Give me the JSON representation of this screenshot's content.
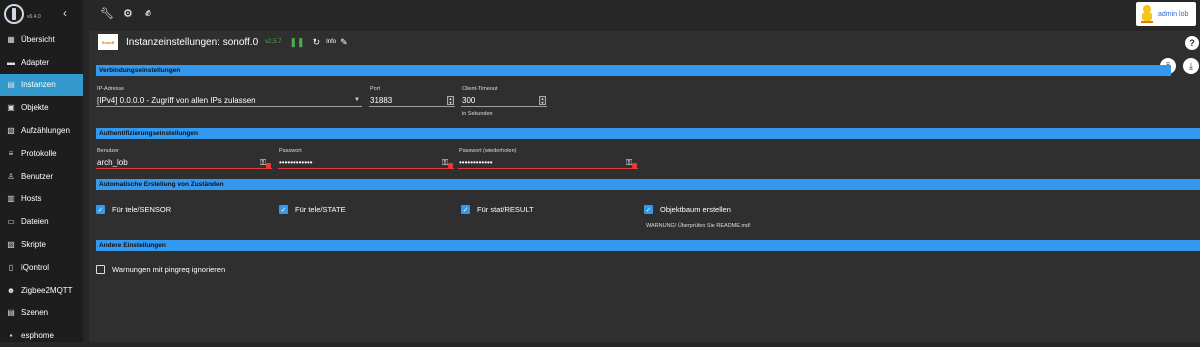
{
  "app": {
    "version": "v6.4.0"
  },
  "sidebar": {
    "items": [
      {
        "label": "Übersicht",
        "icon": "grid-icon",
        "glyph": "▦",
        "active": false
      },
      {
        "label": "Adapter",
        "icon": "store-icon",
        "glyph": "▬",
        "active": false
      },
      {
        "label": "Instanzen",
        "icon": "instances-icon",
        "glyph": "▤",
        "active": true
      },
      {
        "label": "Objekte",
        "icon": "objects-icon",
        "glyph": "▣",
        "active": false
      },
      {
        "label": "Aufzählungen",
        "icon": "enums-icon",
        "glyph": "▧",
        "active": false
      },
      {
        "label": "Protokolle",
        "icon": "logs-icon",
        "glyph": "≡",
        "active": false
      },
      {
        "label": "Benutzer",
        "icon": "user-icon",
        "glyph": "♙",
        "active": false
      },
      {
        "label": "Hosts",
        "icon": "hosts-icon",
        "glyph": "▥",
        "active": false
      },
      {
        "label": "Dateien",
        "icon": "files-icon",
        "glyph": "▭",
        "active": false
      },
      {
        "label": "Skripte",
        "icon": "scripts-icon",
        "glyph": "▨",
        "active": false
      },
      {
        "label": "iQontrol",
        "icon": "iqontrol-icon",
        "glyph": "▯",
        "active": false
      },
      {
        "label": "Zigbee2MQTT",
        "icon": "zigbee-icon",
        "glyph": "☻",
        "active": false
      },
      {
        "label": "Szenen",
        "icon": "scenes-icon",
        "glyph": "▤",
        "active": false
      },
      {
        "label": "esphome",
        "icon": "esphome-icon",
        "glyph": "▪",
        "active": false
      }
    ]
  },
  "topbar": {
    "user_name": "admin lob"
  },
  "instance": {
    "brand": "Sonoff",
    "title": "Instanzeinstellungen: sonoff.0",
    "version": "v2.5.7",
    "info_label": "Info"
  },
  "sections": {
    "connection": "Verbindungseinstellungen",
    "auth": "Authentifizierungseinstellungen",
    "auto_states": "Automatische Erstellung von Zuständen",
    "other": "Andere Einstellungen"
  },
  "connection": {
    "ip_label": "IP-Adresse",
    "ip_value": "[IPv4] 0.0.0.0 - Zugriff von allen IPs zulassen",
    "port_label": "Port",
    "port_value": "31883",
    "timeout_label": "Client-Timeout",
    "timeout_value": "300",
    "timeout_unit": "in Sekunden"
  },
  "auth": {
    "user_label": "Benutzer",
    "user_value": "arch_lob",
    "pw_label": "Passwort",
    "pw_value": "••••••••••••",
    "pw2_label": "Passwort (wiederholen)",
    "pw2_value": "••••••••••••"
  },
  "auto_states": {
    "items": [
      {
        "label": "Für tele/SENSOR",
        "checked": true
      },
      {
        "label": "Für tele/STATE",
        "checked": true
      },
      {
        "label": "Für stat/RESULT",
        "checked": true
      },
      {
        "label": "Objektbaum erstellen",
        "checked": true
      }
    ],
    "warning": "WARNUNG! Überprüfen Sie README.md!"
  },
  "other": {
    "ignore_pingreq_label": "Warnungen mit pingreq ignorieren",
    "ignore_pingreq_checked": false
  },
  "colors": {
    "accent": "#3399ee",
    "active_nav": "#3399cc",
    "version": "#4caf50",
    "error": "#e53935"
  }
}
